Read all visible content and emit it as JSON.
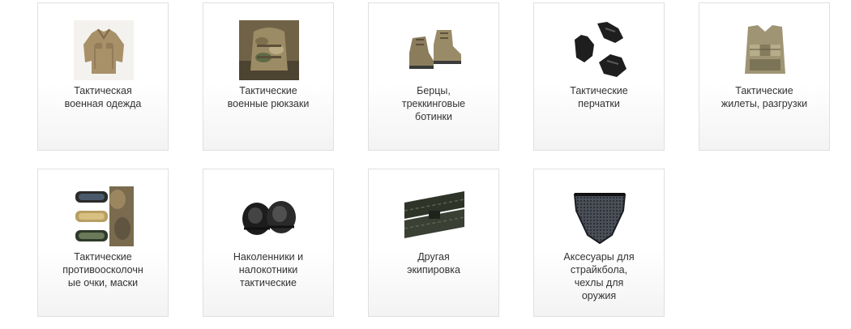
{
  "categories": [
    {
      "lines": [
        "Тактическая",
        "военная одежда"
      ],
      "icon": "tactical-shirt-icon"
    },
    {
      "lines": [
        "Тактические",
        "военные рюкзаки"
      ],
      "icon": "backpack-icon"
    },
    {
      "lines": [
        "Берцы,",
        "треккинговые",
        "ботинки"
      ],
      "icon": "boots-icon"
    },
    {
      "lines": [
        "Тактические",
        "перчатки"
      ],
      "icon": "gloves-icon"
    },
    {
      "lines": [
        "Тактические",
        "жилеты, разгрузки"
      ],
      "icon": "vest-icon"
    },
    {
      "lines": [
        "Тактические",
        "противоосколочн",
        "ые очки, маски"
      ],
      "icon": "goggles-icon"
    },
    {
      "lines": [
        "Наколенники и",
        "налокотники",
        "тактические"
      ],
      "icon": "knee-pads-icon"
    },
    {
      "lines": [
        "Другая",
        "экипировка"
      ],
      "icon": "belt-icon"
    },
    {
      "lines": [
        "Аксесуары для",
        "страйкбола,",
        "чехлы для",
        "оружия"
      ],
      "icon": "mesh-mask-icon"
    }
  ]
}
